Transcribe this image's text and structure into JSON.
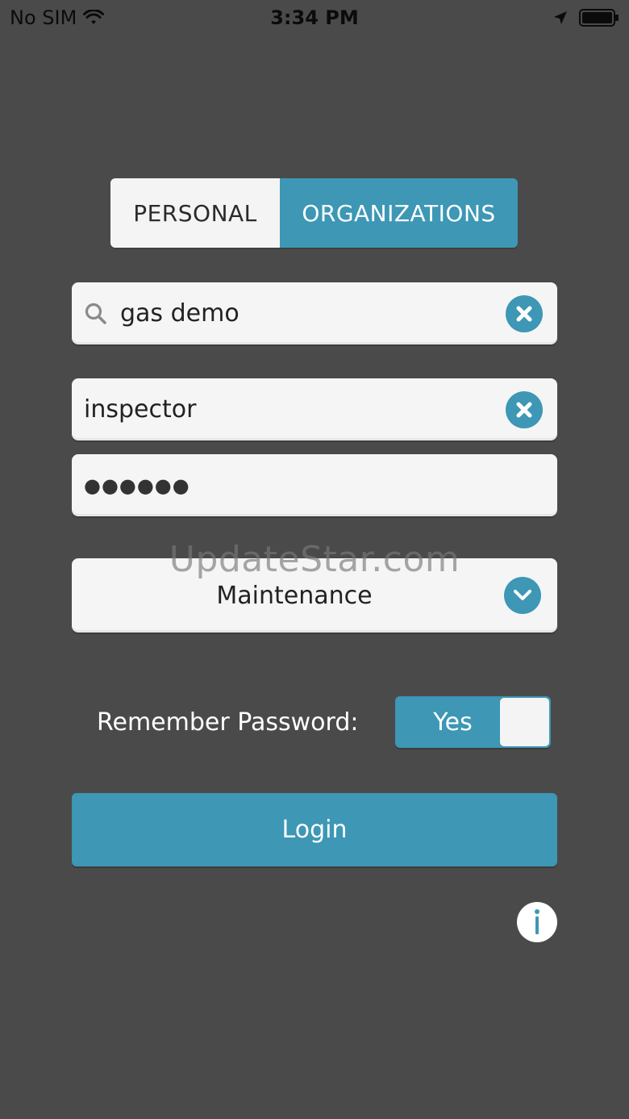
{
  "status_bar": {
    "carrier": "No SIM",
    "time": "3:34 PM",
    "icons": [
      "wifi-icon",
      "location-arrow-icon",
      "battery-icon"
    ]
  },
  "segmented": {
    "personal_label": "PERSONAL",
    "organizations_label": "ORGANIZATIONS",
    "selected": "ORGANIZATIONS"
  },
  "form": {
    "organization_search_value": "gas demo",
    "username_value": "inspector",
    "password_masked": "●●●●●●",
    "role_selected": "Maintenance"
  },
  "remember_password": {
    "label": "Remember Password:",
    "toggle_label": "Yes",
    "state": "on"
  },
  "login": {
    "label": "Login"
  },
  "watermark": {
    "text": "UpdateStar.com"
  },
  "info": {
    "icon": "info-icon"
  },
  "colors": {
    "background": "#4a4a4a",
    "accent": "#3d97b5",
    "field_bg": "#f5f5f5",
    "text_light": "#ffffff"
  }
}
